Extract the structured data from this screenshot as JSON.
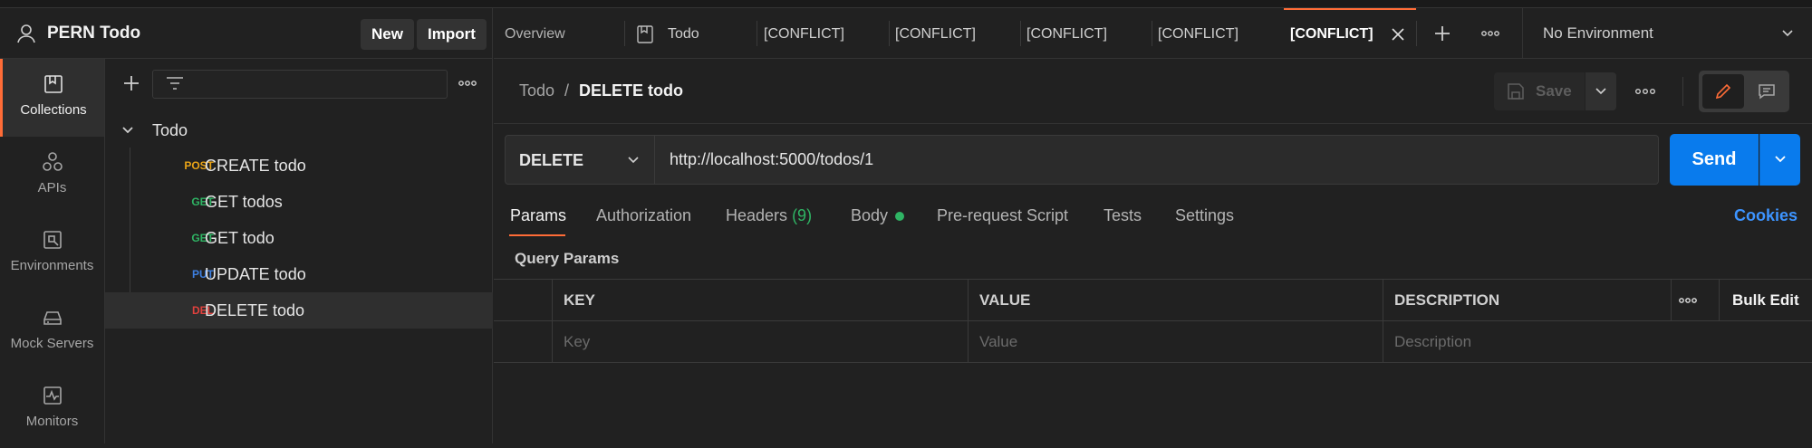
{
  "workspace": {
    "title": "PERN Todo",
    "new_label": "New",
    "import_label": "Import"
  },
  "sidebar": {
    "items": [
      {
        "label": "Collections",
        "icon": "collections-icon",
        "active": true
      },
      {
        "label": "APIs",
        "icon": "apis-icon",
        "active": false
      },
      {
        "label": "Environments",
        "icon": "environments-icon",
        "active": false
      },
      {
        "label": "Mock Servers",
        "icon": "mock-servers-icon",
        "active": false
      },
      {
        "label": "Monitors",
        "icon": "monitors-icon",
        "active": false
      }
    ]
  },
  "collection": {
    "name": "Todo",
    "requests": [
      {
        "method": "POST",
        "name": "CREATE todo",
        "color": "#e8a317"
      },
      {
        "method": "GET",
        "name": "GET todos",
        "color": "#2fb464"
      },
      {
        "method": "GET",
        "name": "GET todo",
        "color": "#2fb464"
      },
      {
        "method": "PUT",
        "name": "UPDATE todo",
        "color": "#3d7fe0"
      },
      {
        "method": "DEL",
        "name": "DELETE todo",
        "color": "#e0413d",
        "active": true
      }
    ]
  },
  "tabs": {
    "overview": "Overview",
    "todo": "Todo",
    "conflicts": [
      "[CONFLICT]",
      "[CONFLICT]",
      "[CONFLICT]",
      "[CONFLICT]",
      "[CONFLICT]"
    ]
  },
  "environment": {
    "selected": "No Environment"
  },
  "request": {
    "breadcrumb_parent": "Todo",
    "breadcrumb_sep": "/",
    "breadcrumb_current": "DELETE todo",
    "save_label": "Save",
    "method": "DELETE",
    "url": "http://localhost:5000/todos/1",
    "send_label": "Send"
  },
  "request_tabs": {
    "params": "Params",
    "authorization": "Authorization",
    "headers": "Headers",
    "headers_count": "(9)",
    "body": "Body",
    "pre_request": "Pre-request Script",
    "tests": "Tests",
    "settings": "Settings",
    "cookies": "Cookies"
  },
  "query_params": {
    "title": "Query Params",
    "columns": [
      "KEY",
      "VALUE",
      "DESCRIPTION"
    ],
    "placeholders": [
      "Key",
      "Value",
      "Description"
    ],
    "bulk_edit": "Bulk Edit"
  },
  "colors": {
    "accent": "#ff6c37",
    "send": "#097bed",
    "link": "#3d94ff",
    "success": "#2fb464"
  }
}
